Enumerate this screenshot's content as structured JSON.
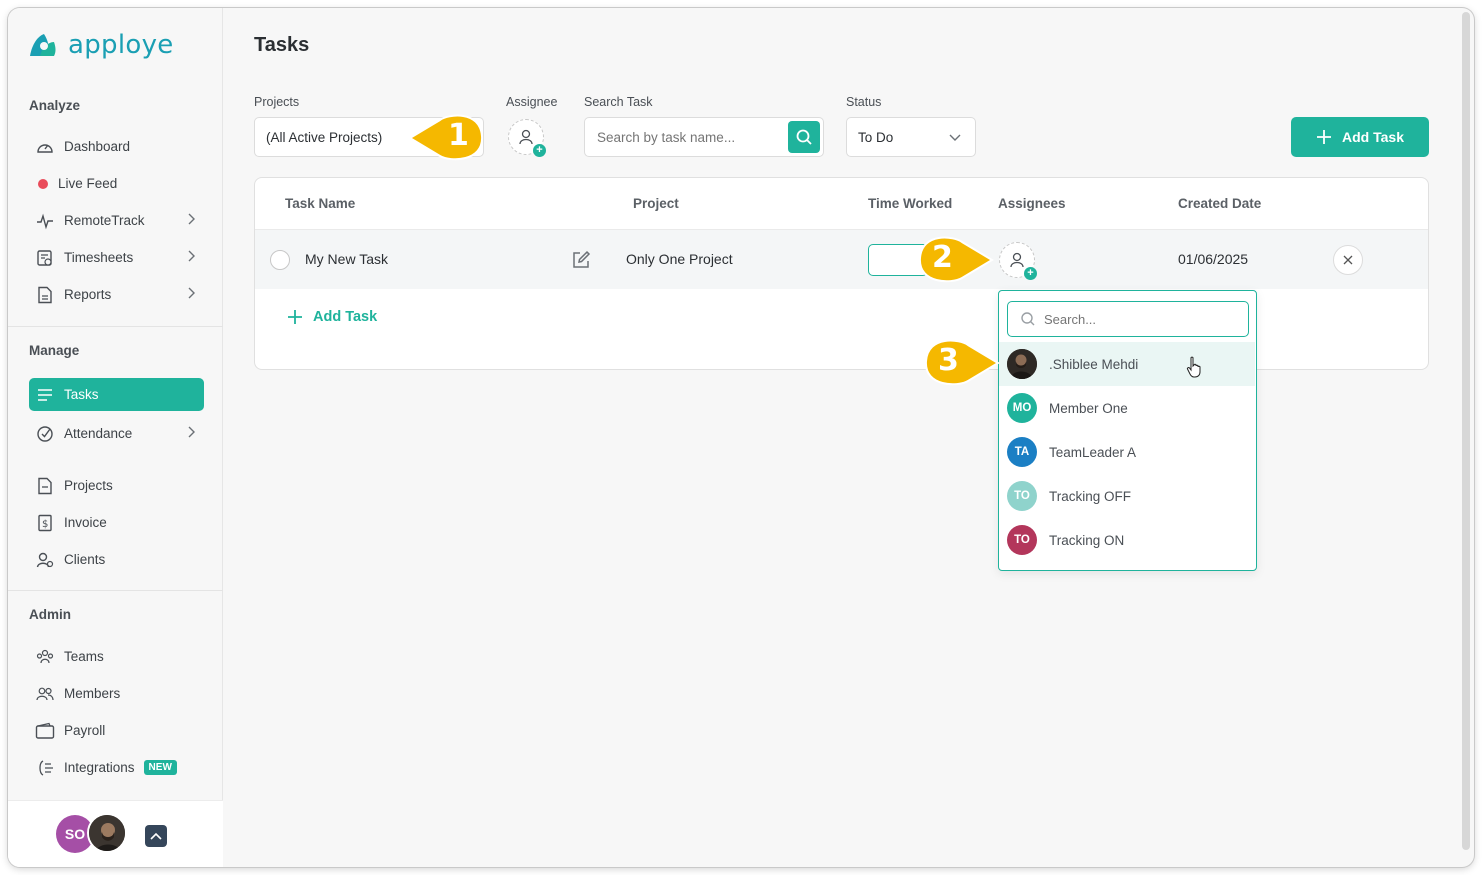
{
  "app": {
    "logo_text": "apploye",
    "brand_color": "#1fb39c"
  },
  "sidebar": {
    "sections": {
      "analyze": "Analyze",
      "manage": "Manage",
      "admin": "Admin"
    },
    "items": {
      "dashboard": {
        "label": "Dashboard",
        "icon": "dashboard-gauge-icon"
      },
      "live_feed": {
        "label": "Live Feed",
        "icon": "live-dot-icon"
      },
      "remotetrack": {
        "label": "RemoteTrack",
        "icon": "pulse-icon"
      },
      "timesheets": {
        "label": "Timesheets",
        "icon": "timesheet-icon"
      },
      "reports": {
        "label": "Reports",
        "icon": "report-icon"
      },
      "tasks": {
        "label": "Tasks",
        "icon": "list-icon"
      },
      "attendance": {
        "label": "Attendance",
        "icon": "attendance-icon"
      },
      "projects": {
        "label": "Projects",
        "icon": "project-icon"
      },
      "invoice": {
        "label": "Invoice",
        "icon": "invoice-icon"
      },
      "clients": {
        "label": "Clients",
        "icon": "client-icon"
      },
      "teams": {
        "label": "Teams",
        "icon": "teams-icon"
      },
      "members": {
        "label": "Members",
        "icon": "members-icon"
      },
      "payroll": {
        "label": "Payroll",
        "icon": "wallet-icon"
      },
      "integrations": {
        "label": "Integrations",
        "icon": "integrations-icon",
        "badge": "NEW"
      }
    },
    "footer": {
      "user_initials": "SO"
    }
  },
  "main": {
    "title": "Tasks",
    "filters": {
      "projects_label": "Projects",
      "projects_value": "(All Active Projects)",
      "assignee_label": "Assignee",
      "search_label": "Search Task",
      "search_placeholder": "Search by task name...",
      "status_label": "Status",
      "status_value": "To Do"
    },
    "add_task_button": "Add Task",
    "table": {
      "headers": {
        "task_name": "Task Name",
        "project": "Project",
        "time_worked": "Time Worked",
        "assignees": "Assignees",
        "created_date": "Created Date"
      },
      "rows": [
        {
          "task_name": "My New Task",
          "project": "Only One Project",
          "time_worked": "",
          "created_date": "01/06/2025"
        }
      ],
      "add_task_link": "Add Task"
    },
    "assignee_dropdown": {
      "search_placeholder": "Search...",
      "members": [
        {
          "name": ".Shiblee Mehdi",
          "initials": "",
          "color": "#3a3a3a",
          "photo": true
        },
        {
          "name": "Member One",
          "initials": "MO",
          "color": "#1fb39c"
        },
        {
          "name": "TeamLeader A",
          "initials": "TA",
          "color": "#1b7fc4"
        },
        {
          "name": "Tracking OFF",
          "initials": "TO",
          "color": "#8fd3cc"
        },
        {
          "name": "Tracking ON",
          "initials": "TO",
          "color": "#b3365b"
        }
      ]
    }
  },
  "callouts": [
    "1",
    "2",
    "3"
  ],
  "callout_color": "#f5b800"
}
